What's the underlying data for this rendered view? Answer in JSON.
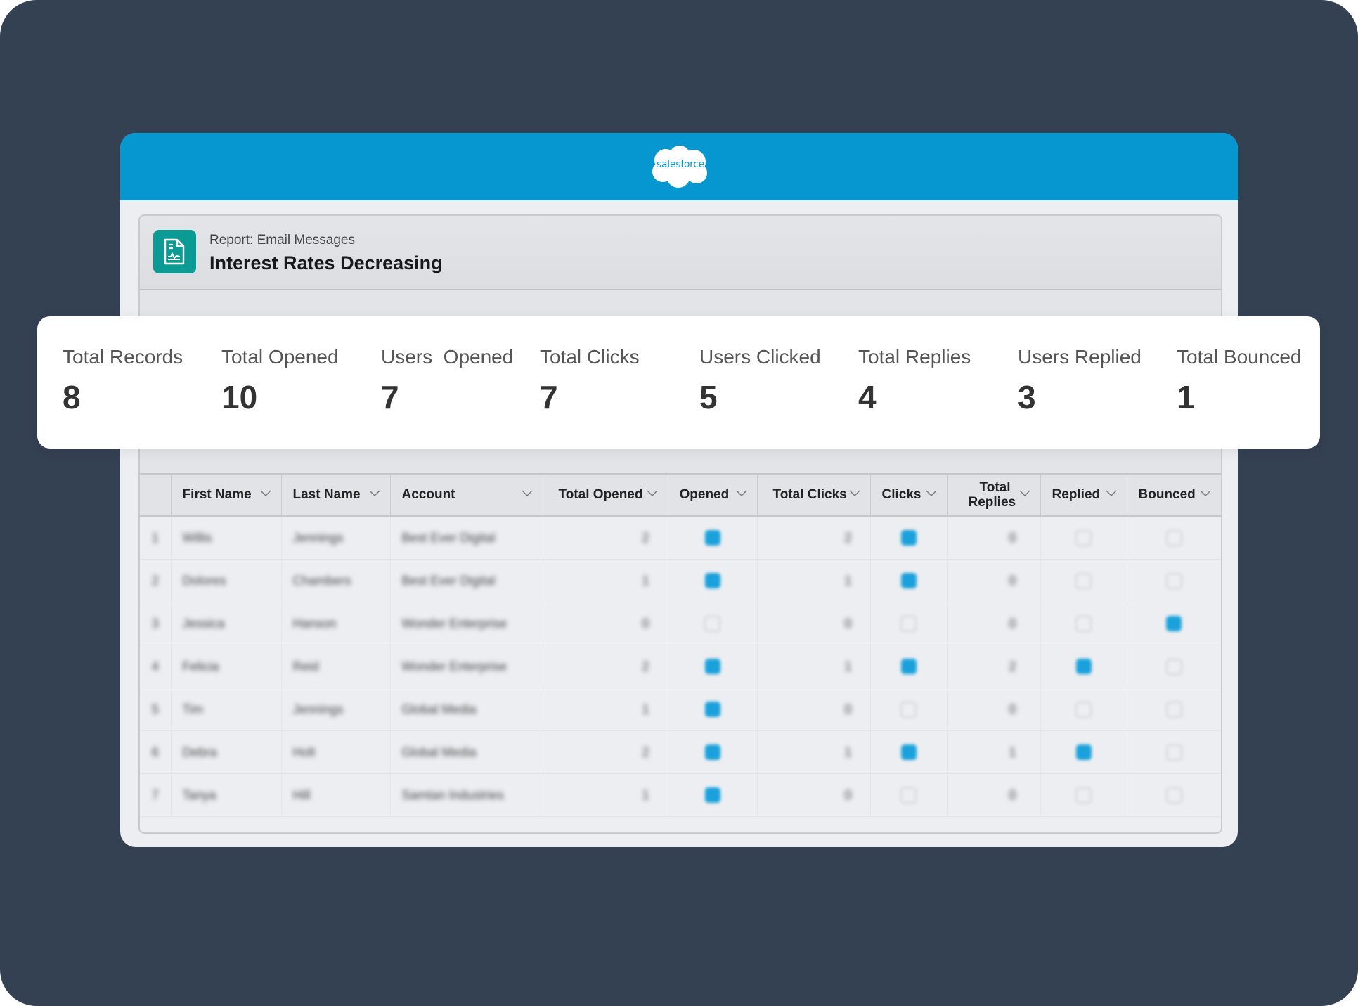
{
  "app": {
    "brand": "salesforce",
    "brand_color": "#0696d0",
    "accent_color": "#1aa1dc"
  },
  "report": {
    "icon": "report-document-icon",
    "kicker": "Report: Email Messages",
    "title": "Interest Rates Decreasing"
  },
  "stats": [
    {
      "label": "Total Records",
      "value": "8"
    },
    {
      "label": "Total Opened",
      "value": "10"
    },
    {
      "label": "Users  Opened",
      "value": "7"
    },
    {
      "label": "Total Clicks",
      "value": "7"
    },
    {
      "label": "Users Clicked",
      "value": "5"
    },
    {
      "label": "Total Replies",
      "value": "4"
    },
    {
      "label": "Users Replied",
      "value": "3"
    },
    {
      "label": "Total Bounced",
      "value": "1"
    }
  ],
  "table": {
    "columns": [
      {
        "label": "First Name"
      },
      {
        "label": "Last Name"
      },
      {
        "label": "Account"
      },
      {
        "label": "Total Opened"
      },
      {
        "label": "Opened"
      },
      {
        "label": "Total Clicks"
      },
      {
        "label": "Clicks"
      },
      {
        "label": "Total Replies"
      },
      {
        "label": "Replied"
      },
      {
        "label": "Bounced"
      }
    ],
    "rows": [
      {
        "n": "1",
        "first": "Willis",
        "last": "Jennings",
        "account": "Best Ever Digital",
        "total_opened": "2",
        "opened": true,
        "total_clicks": "2",
        "clicks": true,
        "total_replies": "0",
        "replied": false,
        "bounced": false
      },
      {
        "n": "2",
        "first": "Dolores",
        "last": "Chambers",
        "account": "Best Ever Digital",
        "total_opened": "1",
        "opened": true,
        "total_clicks": "1",
        "clicks": true,
        "total_replies": "0",
        "replied": false,
        "bounced": false
      },
      {
        "n": "3",
        "first": "Jessica",
        "last": "Hanson",
        "account": "Wonder Enterprise",
        "total_opened": "0",
        "opened": false,
        "total_clicks": "0",
        "clicks": false,
        "total_replies": "0",
        "replied": false,
        "bounced": true
      },
      {
        "n": "4",
        "first": "Felicia",
        "last": "Reid",
        "account": "Wonder Enterprise",
        "total_opened": "2",
        "opened": true,
        "total_clicks": "1",
        "clicks": true,
        "total_replies": "2",
        "replied": true,
        "bounced": false
      },
      {
        "n": "5",
        "first": "Tim",
        "last": "Jennings",
        "account": "Global Media",
        "total_opened": "1",
        "opened": true,
        "total_clicks": "0",
        "clicks": false,
        "total_replies": "0",
        "replied": false,
        "bounced": false
      },
      {
        "n": "6",
        "first": "Debra",
        "last": "Holt",
        "account": "Global Media",
        "total_opened": "2",
        "opened": true,
        "total_clicks": "1",
        "clicks": true,
        "total_replies": "1",
        "replied": true,
        "bounced": false
      },
      {
        "n": "7",
        "first": "Tanya",
        "last": "Hill",
        "account": "Samtan Industries",
        "total_opened": "1",
        "opened": true,
        "total_clicks": "0",
        "clicks": false,
        "total_replies": "0",
        "replied": false,
        "bounced": false
      }
    ]
  }
}
